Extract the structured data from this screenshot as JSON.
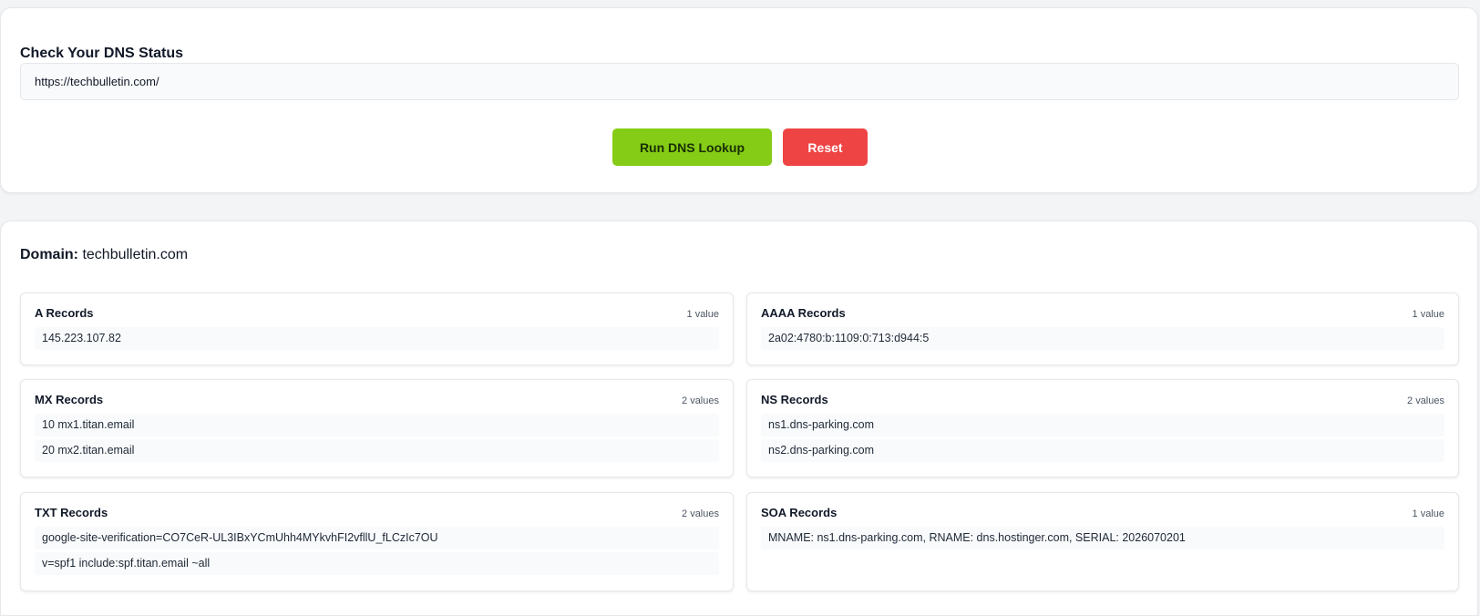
{
  "search": {
    "title": "Check Your DNS Status",
    "url_value": "https://techbulletin.com/",
    "run_label": "Run DNS Lookup",
    "reset_label": "Reset"
  },
  "results": {
    "domain_label": "Domain:",
    "domain_value": "techbulletin.com",
    "cards": [
      {
        "title": "A Records",
        "count": "1 value",
        "records": [
          "145.223.107.82"
        ]
      },
      {
        "title": "AAAA Records",
        "count": "1 value",
        "records": [
          "2a02:4780:b:1109:0:713:d944:5"
        ]
      },
      {
        "title": "MX Records",
        "count": "2 values",
        "records": [
          "10 mx1.titan.email",
          "20 mx2.titan.email"
        ]
      },
      {
        "title": "NS Records",
        "count": "2 values",
        "records": [
          "ns1.dns-parking.com",
          "ns2.dns-parking.com"
        ]
      },
      {
        "title": "TXT Records",
        "count": "2 values",
        "records": [
          "google-site-verification=CO7CeR-UL3IBxYCmUhh4MYkvhFI2vfllU_fLCzIc7OU",
          "v=spf1 include:spf.titan.email ~all"
        ]
      },
      {
        "title": "SOA Records",
        "count": "1 value",
        "records": [
          "MNAME: ns1.dns-parking.com, RNAME: dns.hostinger.com, SERIAL: 2026070201"
        ]
      }
    ]
  },
  "colors": {
    "run_button": "#84cc16",
    "reset_button": "#ef4444"
  }
}
